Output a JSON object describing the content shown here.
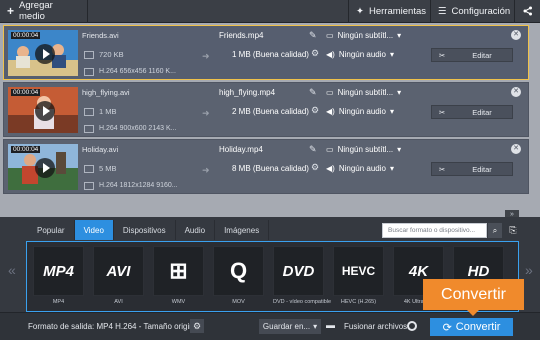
{
  "toolbar": {
    "add_label": "Agregar medio",
    "tools_label": "Herramientas",
    "settings_label": "Configuración"
  },
  "files": [
    {
      "duration": "00:00:04",
      "src_name": "Friends.avi",
      "src_size": "720 KB",
      "src_info": "H.264 656x456 1160 K...",
      "out_name": "Friends.mp4",
      "out_size": "1 MB (Buena calidad)",
      "subtitles": "Ningún subtítl...",
      "audio": "Ningún audio",
      "edit": "Editar"
    },
    {
      "duration": "00:00:04",
      "src_name": "high_flying.avi",
      "src_size": "1 MB",
      "src_info": "H.264 900x600 2143 K...",
      "out_name": "high_flying.mp4",
      "out_size": "2 MB (Buena calidad)",
      "subtitles": "Ningún subtítl...",
      "audio": "Ningún audio",
      "edit": "Editar"
    },
    {
      "duration": "00:00:04",
      "src_name": "Holiday.avi",
      "src_size": "5 MB",
      "src_info": "H.264 1812x1284 9160...",
      "out_name": "Holiday.mp4",
      "out_size": "8 MB (Buena calidad)",
      "subtitles": "Ningún subtítl...",
      "audio": "Ningún audio",
      "edit": "Editar"
    }
  ],
  "tabs": [
    "Popular",
    "Video",
    "Dispositivos",
    "Audio",
    "Imágenes"
  ],
  "active_tab": "Video",
  "search": {
    "placeholder": "Buscar formato o dispositivo..."
  },
  "formats": [
    {
      "label": "MP4",
      "caption": "MP4"
    },
    {
      "label": "AVI",
      "caption": "AVI"
    },
    {
      "label": "⊞",
      "caption": "WMV"
    },
    {
      "label": "Q",
      "caption": "MOV"
    },
    {
      "label": "DVD",
      "caption": "DVD - vídeo compatible"
    },
    {
      "label": "HEVC",
      "caption": "HEVC (H.265)"
    },
    {
      "label": "4K",
      "caption": "4K Ultra HD"
    },
    {
      "label": "HD",
      "caption": ""
    }
  ],
  "bottom": {
    "output_format": "Formato de salida: MP4 H.264 - Tamaño original",
    "save_label": "Guardar en...",
    "merge_label": "Fusionar archivos",
    "convert_label": "Convertir"
  },
  "tooltip": "Convertir",
  "colors": {
    "accent": "#2d8fe0",
    "selection": "#f0c24a",
    "tooltip": "#f08a2c"
  }
}
